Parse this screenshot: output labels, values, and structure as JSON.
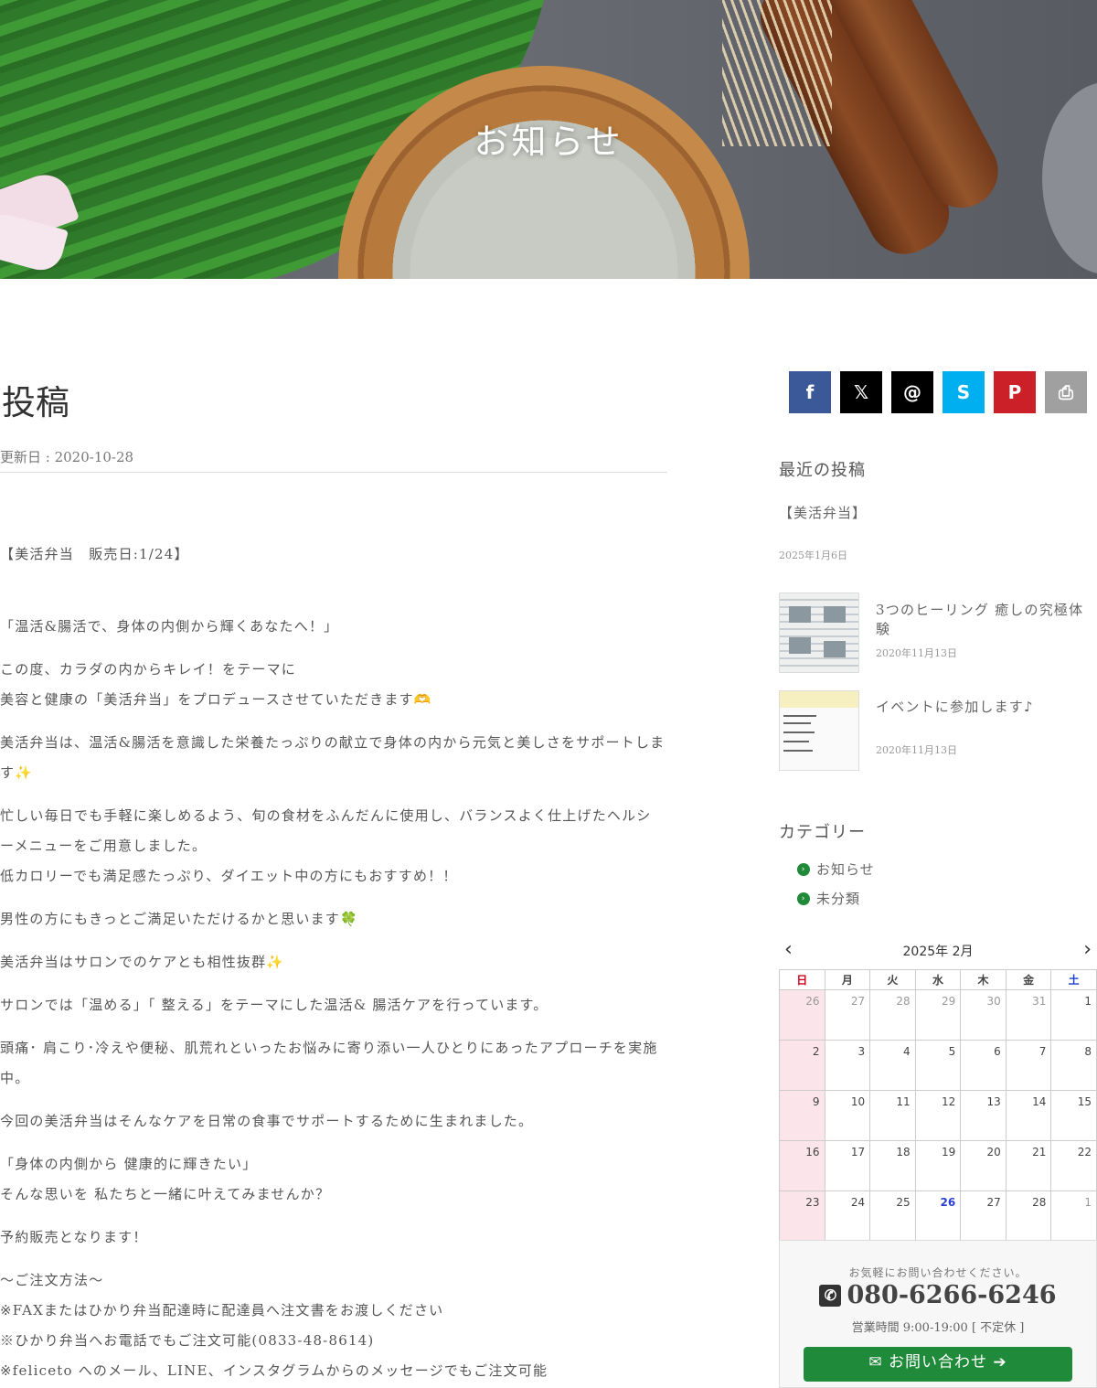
{
  "hero": {
    "title": "お知らせ"
  },
  "post": {
    "title": "投稿",
    "updated": "更新日 : 2020-10-28",
    "paragraphs": [
      "【美活弁当　販売日:1/24】",
      "「温活&腸活で、身体の内側から輝くあなたへ！」",
      "この度、カラダの内からキレイ！をテーマに",
      "美容と健康の「美活弁当」をプロデュースさせていただきます🫶",
      "美活弁当は、温活&腸活を意識した栄養たっぷりの献立で身体の内から元気と美しさをサポートしま",
      "す✨",
      "忙しい毎日でも手軽に楽しめるよう、旬の食材をふんだんに使用し、バランスよく仕上げたヘルシ",
      "ーメニューをご用意しました。",
      "低カロリーでも満足感たっぷり、ダイエット中の方にもおすすめ！！",
      "男性の方にもきっとご満足いただけるかと思います🍀",
      "美活弁当はサロンでのケアとも相性抜群✨",
      "サロンでは「温める」「 整える」をテーマにした温活& 腸活ケアを行っています。",
      "頭痛･ 肩こり･冷えや便秘、肌荒れといったお悩みに寄り添い一人ひとりにあったアプローチを実施",
      "中。",
      "今回の美活弁当はそんなケアを日常の食事でサポートするために生まれました。",
      "「身体の内側から 健康的に輝きたい」",
      "そんな思いを 私たちと一緒に叶えてみませんか？",
      "予約販売となります！",
      "〜ご注文方法〜",
      "※FAXまたはひかり弁当配達時に配達員へ注文書をお渡しください",
      "※ひかり弁当へお電話でもご注文可能(0833-48-8614)",
      "※feliceto へのメール、LINE、インスタグラムからのメッセージでもご注文可能"
    ]
  },
  "share": {
    "buttons": [
      {
        "icon": "facebook-icon",
        "glyph": "f",
        "color": "#3b5998"
      },
      {
        "icon": "x-icon",
        "glyph": "𝕏",
        "color": "#000000"
      },
      {
        "icon": "threads-icon",
        "glyph": "@",
        "color": "#000000"
      },
      {
        "icon": "skype-icon",
        "glyph": "S",
        "color": "#00aff0"
      },
      {
        "icon": "pinterest-icon",
        "glyph": "P",
        "color": "#cb2027"
      },
      {
        "icon": "print-icon",
        "glyph": "⎙",
        "color": "#a0a0a0"
      }
    ]
  },
  "recent": {
    "heading": "最近の投稿",
    "first": {
      "title": "【美活弁当】",
      "date": "2025年1月6日"
    },
    "items": [
      {
        "title": "3つのヒーリング 癒しの究極体験",
        "date": "2020年11月13日"
      },
      {
        "title": "イベントに参加します♪",
        "date": "2020年11月13日"
      }
    ]
  },
  "categories": {
    "heading": "カテゴリー",
    "items": [
      "お知らせ",
      "未分類"
    ]
  },
  "calendar": {
    "title": "2025年 2月",
    "weekdays": [
      "日",
      "月",
      "火",
      "水",
      "木",
      "金",
      "土"
    ],
    "weekday_colors": {
      "sun": "#d0021b",
      "sat": "#1a3fc7"
    },
    "weeks": [
      [
        "26",
        "27",
        "28",
        "29",
        "30",
        "31",
        "1"
      ],
      [
        "2",
        "3",
        "4",
        "5",
        "6",
        "7",
        "8"
      ],
      [
        "9",
        "10",
        "11",
        "12",
        "13",
        "14",
        "15"
      ],
      [
        "16",
        "17",
        "18",
        "19",
        "20",
        "21",
        "22"
      ],
      [
        "23",
        "24",
        "25",
        "26",
        "27",
        "28",
        "1"
      ]
    ],
    "today": "26"
  },
  "contact": {
    "tagline": "お気軽にお問い合わせください。",
    "phone": "080-6266-6246",
    "hours": "営業時間 9:00-19:00 [ 不定休 ]",
    "button": "お問い合わせ",
    "accent": "#1f8a3a"
  }
}
